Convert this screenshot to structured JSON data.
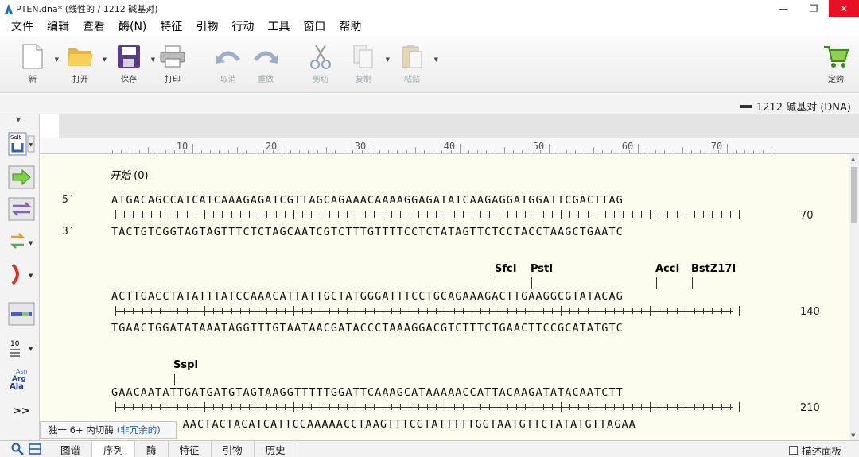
{
  "window": {
    "title": "PTEN.dna* (线性的 / 1212 碱基对)"
  },
  "menu": [
    "文件",
    "编辑",
    "查看",
    "酶(N)",
    "特征",
    "引物",
    "行动",
    "工具",
    "窗口",
    "帮助"
  ],
  "toolbar": {
    "new": "新",
    "open": "打开",
    "save": "保存",
    "print": "打印",
    "undo": "取消",
    "redo": "重做",
    "cut": "剪切",
    "copy": "复制",
    "paste": "粘贴",
    "order": "定购"
  },
  "status": {
    "length": "1212 碱基对 (DNA)"
  },
  "ruler": {
    "labels": [
      "10",
      "20",
      "30",
      "40",
      "50",
      "60",
      "70"
    ]
  },
  "sequence": {
    "strand_top": "5′",
    "strand_bottom": "3′",
    "feature_label": "开始",
    "feature_count": "(0)",
    "rows": [
      {
        "top": "ATGACAGCCATCATCAAAGAGATCGTTAGCAGAAACAAAAGGAGATATCAAGAGGATGGATTCGACTTAG",
        "bottom": "TACTGTCGGTAGTAGTTTCTCTAGCAATCGTCTTTGTTTTCCTCTATAGTTCTCCTACCTAAGCTGAATC",
        "end": "70"
      },
      {
        "top": "ACTTGACCTATATTTATCCAAACATTATTGCTATGGGATTTCCTGCAGAAAGACTTGAAGGCGTATACAG",
        "bottom": "TGAACTGGATATAAATAGGTTTGTAATAACGATACCCTAAAGGACGTCTTTCTGAACTTCCGCATATGTC",
        "end": "140"
      },
      {
        "top": "GAACAATATTGATGATGTAGTAAGGTTTTTGGATTCAAAGCATAAAAACCATTACAAGATATACAATCTT",
        "bottom": "AACTACTACATCATTCCAAAAACCTAAGTTTCGTATTTTTGGTAATGTTCTATATGTTAGAA",
        "end": "210"
      }
    ],
    "enzymes_row2": [
      "SfcI",
      "PstI",
      "AccI",
      "BstZ17I"
    ],
    "enzymes_row3": [
      "SspI"
    ]
  },
  "enzyme_filter": {
    "text": "独一 6+ 内切酶",
    "note": "(非冗余的)"
  },
  "left_tools": {
    "salt_label": "Salt",
    "number_label": "10",
    "aa_asn": "Asn",
    "aa_arg": "Arg",
    "aa_ala": "Ala",
    "more": ">>"
  },
  "tabs": [
    "图谱",
    "序列",
    "酶",
    "特征",
    "引物",
    "历史"
  ],
  "active_tab": "序列",
  "description_panel": "描述面板",
  "colors": {
    "close": "#e81123",
    "canvas": "#fdfcee",
    "link": "#1565c0"
  }
}
